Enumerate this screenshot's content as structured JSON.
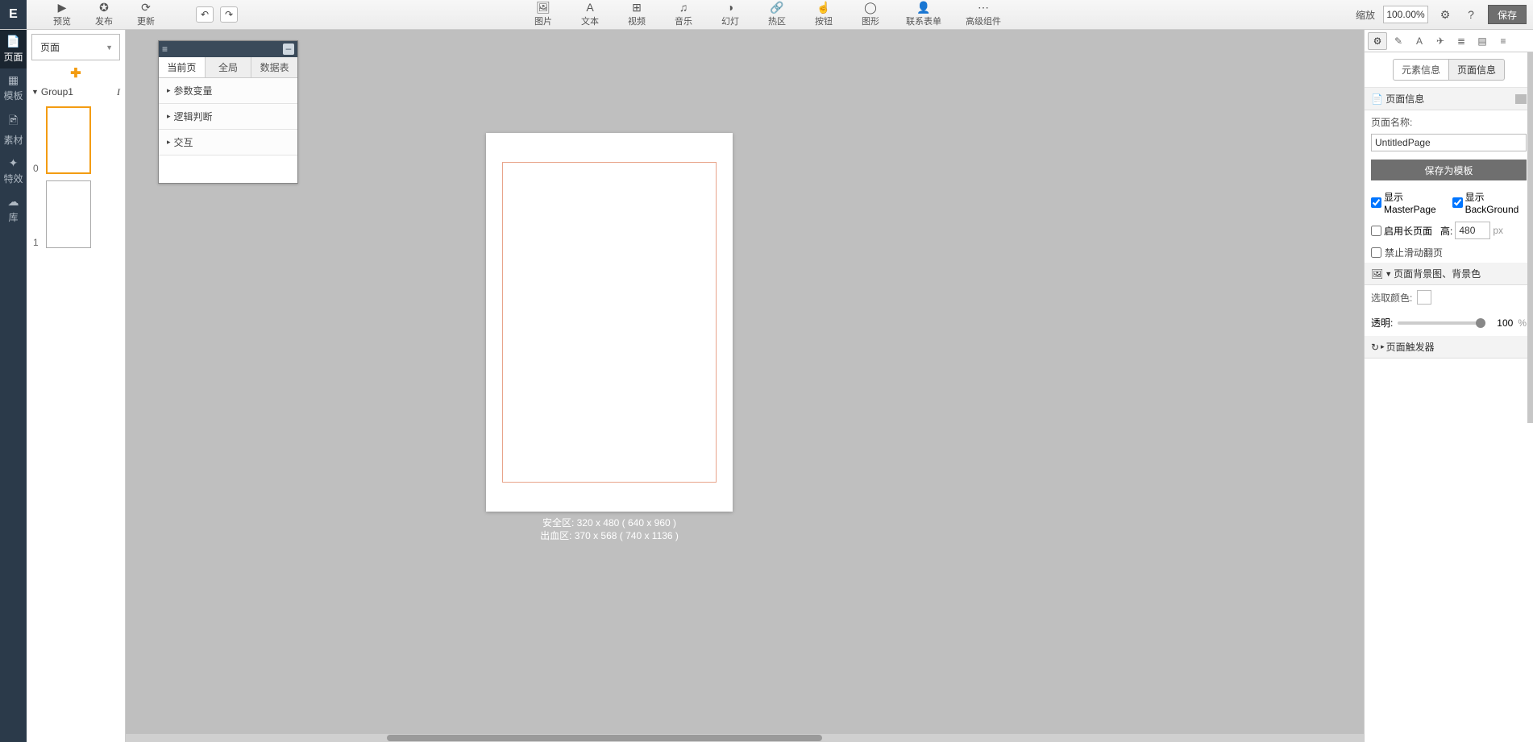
{
  "topbar": {
    "logo": "E",
    "left": [
      {
        "icon": "▶",
        "label": "预览"
      },
      {
        "icon": "✪",
        "label": "发布"
      },
      {
        "icon": "⟳",
        "label": "更新"
      }
    ],
    "undo": "↶",
    "redo": "↷",
    "center": [
      {
        "icon": "🖼",
        "label": "图片"
      },
      {
        "icon": "A",
        "label": "文本"
      },
      {
        "icon": "⊞",
        "label": "视频"
      },
      {
        "icon": "♫",
        "label": "音乐"
      },
      {
        "icon": "◑",
        "label": "幻灯"
      },
      {
        "icon": "🔗",
        "label": "热区"
      },
      {
        "icon": "☝",
        "label": "按钮"
      },
      {
        "icon": "◯",
        "label": "图形"
      },
      {
        "icon": "👤",
        "label": "联系表单"
      },
      {
        "icon": "⋯",
        "label": "高级组件"
      }
    ],
    "zoom_label": "缩放",
    "zoom_value": "100.00%",
    "right_icons": [
      "⚙",
      "?"
    ],
    "save": "保存"
  },
  "vnav": [
    {
      "icon": "📄",
      "label": "页面",
      "active": true
    },
    {
      "icon": "▦",
      "label": "模板"
    },
    {
      "icon": "🖻",
      "label": "素材"
    },
    {
      "icon": "✦",
      "label": "特效"
    },
    {
      "icon": "☁",
      "label": "库"
    }
  ],
  "pages": {
    "type_label": "页面",
    "group": "Group1",
    "thumbs": [
      {
        "num": "0",
        "active": true
      },
      {
        "num": "1",
        "active": false
      }
    ]
  },
  "float": {
    "tabs": [
      "当前页",
      "全局",
      "数据表"
    ],
    "sections": [
      "参数变量",
      "逻辑判断",
      "交互"
    ]
  },
  "canvas": {
    "safe": "安全区: 320 x 480 ( 640 x 960 )",
    "bleed": "出血区: 370 x 568 ( 740 x 1136 )"
  },
  "inspector": {
    "tabs": [
      "⚙",
      "✎",
      "A",
      "✈",
      "≣",
      "▤",
      "≡"
    ],
    "modes": [
      "元素信息",
      "页面信息"
    ],
    "page_info_title": "页面信息",
    "name_label": "页面名称:",
    "name_value": "UntitledPage",
    "save_tpl": "保存为模板",
    "show_master": "显示MasterPage",
    "show_bg": "显示BackGround",
    "long_page": "启用长页面",
    "height_label": "高:",
    "height_value": "480",
    "height_unit": "px",
    "lock_scroll": "禁止滑动翻页",
    "bg_section": "页面背景图、背景色",
    "pick_color": "选取颜色:",
    "opacity_label": "透明:",
    "opacity_value": "100",
    "opacity_unit": "%",
    "trigger_section": "页面触发器"
  }
}
